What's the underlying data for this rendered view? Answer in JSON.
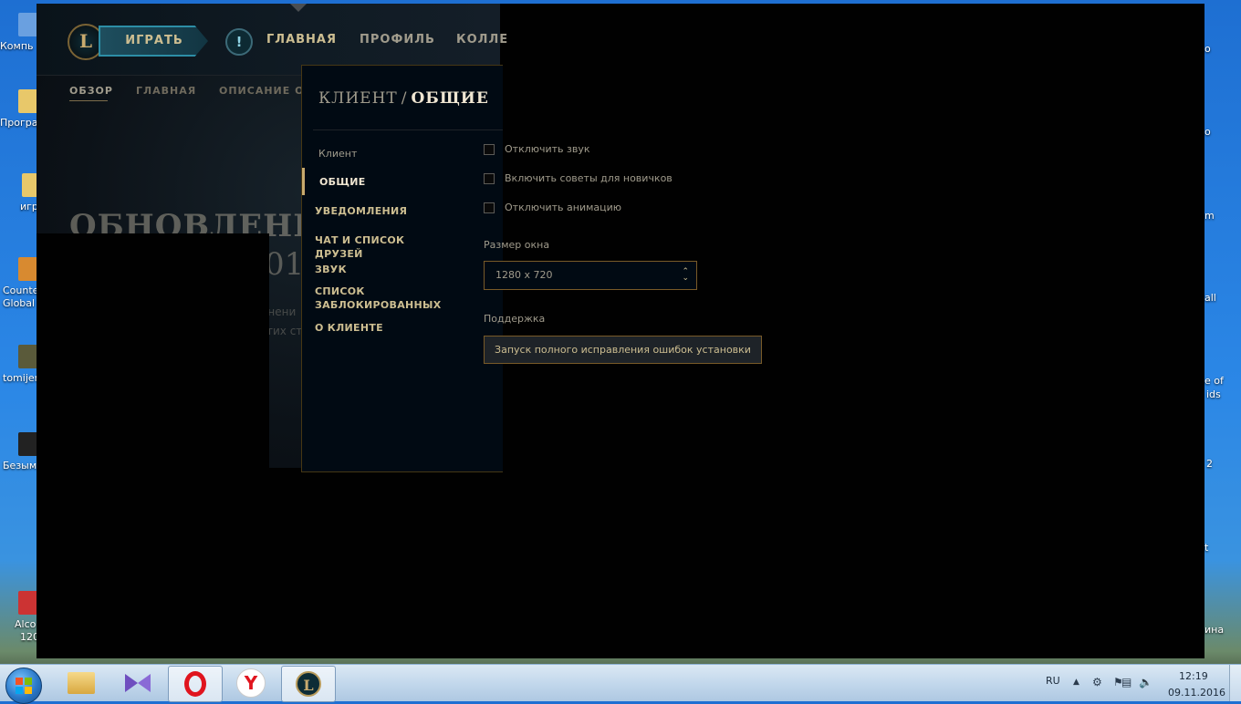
{
  "desktop": {
    "left_icons": [
      {
        "label": "Компь",
        "color": "#6aa0e0"
      },
      {
        "label": "Програ",
        "color": "#e8c86a"
      },
      {
        "label": "игр",
        "color": "#e8c86a"
      },
      {
        "label": "Counte",
        "label2": "Global",
        "color": "#d88a30"
      },
      {
        "label": "tomijer",
        "color": "#5a5a3a"
      },
      {
        "label": "Безым",
        "color": "#222222"
      },
      {
        "label": "Alco",
        "label2": "120",
        "color": "#cc3333"
      }
    ],
    "right_labels": [
      "о",
      "о",
      "m",
      "all",
      "е of",
      "ids",
      "2",
      "t",
      "ина"
    ]
  },
  "client": {
    "logo_letter": "L",
    "play_label": "ИГРАТЬ",
    "nav": [
      "ГЛАВНАЯ",
      "ПРОФИЛЬ",
      "КОЛЛЕ"
    ],
    "subnav": [
      "ОБЗОР",
      "ГЛАВНАЯ",
      "ОПИСАНИЕ О"
    ],
    "hero_title": "ОБНОВЛЕНИ",
    "hero_year": "01",
    "hero_line1": "енени",
    "hero_line2": "тих ст"
  },
  "settings": {
    "breadcrumb": "КЛИЕНТ",
    "separator": "/",
    "current": "ОБЩИЕ",
    "sidebar_header": "Клиент",
    "sidebar_items": [
      "ОБЩИЕ",
      "УВЕДОМЛЕНИЯ",
      "ЧАТ И СПИСОК ДРУЗЕЙ",
      "ЗВУК",
      "СПИСОК ЗАБЛОКИРОВАННЫХ",
      "О КЛИЕНТЕ"
    ],
    "checkboxes": [
      {
        "label": "Отключить звук",
        "checked": false
      },
      {
        "label": "Включить советы для новичков",
        "checked": false
      },
      {
        "label": "Отключить анимацию",
        "checked": false
      }
    ],
    "window_size_label": "Размер окна",
    "window_size_value": "1280 x 720",
    "support_label": "Поддержка",
    "repair_button": "Запуск полного исправления ошибок установки"
  },
  "taskbar": {
    "language": "RU",
    "time": "12:19",
    "date": "09.11.2016"
  }
}
